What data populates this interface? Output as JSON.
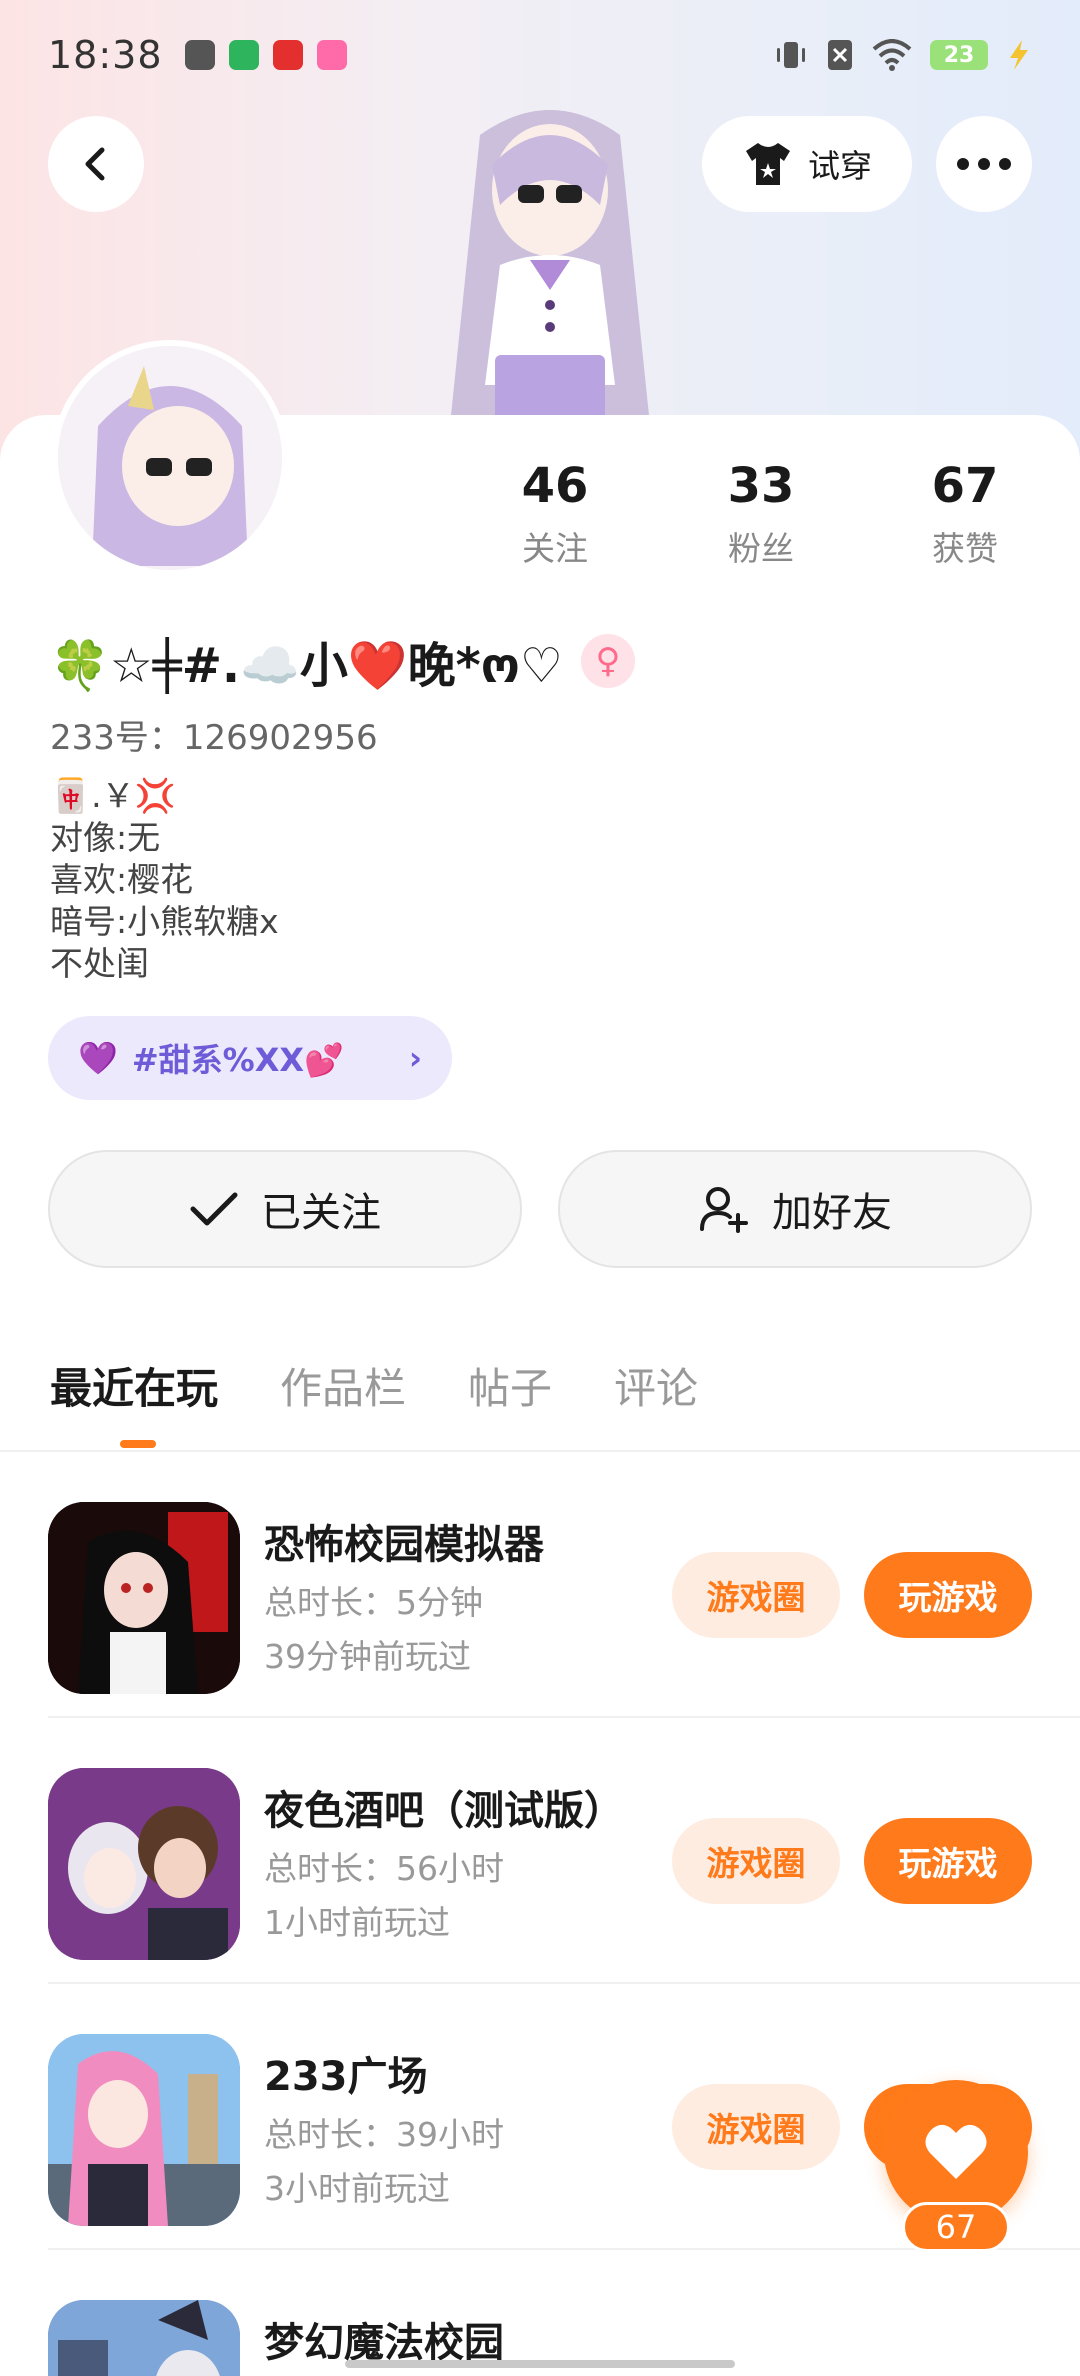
{
  "status_bar": {
    "time": "18:38",
    "battery": "23"
  },
  "header": {
    "try_on_label": "试穿"
  },
  "stats": [
    {
      "value": "46",
      "label": "关注"
    },
    {
      "value": "33",
      "label": "粉丝"
    },
    {
      "value": "67",
      "label": "获赞"
    }
  ],
  "profile": {
    "nickname": "🍀☆╪#.☁️小❤️晚*ო♡",
    "gender_symbol": "♀",
    "user_id": "233号：126902956",
    "bio_lines": [
      "🀄.￥💢",
      "对像:无",
      "喜欢:樱花",
      "暗号:小熊软糖x",
      "不处闺"
    ]
  },
  "tag": {
    "icon": "💜",
    "label": "#甜系%XX💕"
  },
  "actions": {
    "follow_label": "已关注",
    "add_friend_label": "加好友"
  },
  "tabs": [
    "最近在玩",
    "作品栏",
    "帖子",
    "评论"
  ],
  "games": [
    {
      "title": "恐怖校园模拟器",
      "duration": "总时长：5分钟",
      "last_played": "39分钟前玩过",
      "circle_label": "游戏圈",
      "play_label": "玩游戏",
      "icon_color": "#1a0a0a"
    },
    {
      "title": "夜色酒吧（测试版）",
      "duration": "总时长：56小时",
      "last_played": "1小时前玩过",
      "circle_label": "游戏圈",
      "play_label": "玩游戏",
      "icon_color": "#7a3a8a"
    },
    {
      "title": "233广场",
      "duration": "总时长：39小时",
      "last_played": "3小时前玩过",
      "circle_label": "游戏圈",
      "play_label": "玩游戏",
      "icon_color": "#6aa0d8"
    },
    {
      "title": "梦幻魔法校园",
      "duration": "",
      "last_played": "",
      "circle_label": "",
      "play_label": "",
      "icon_color": "#4a6aa8"
    }
  ],
  "fab": {
    "like_count": "67"
  },
  "colors": {
    "accent": "#ff7a1a",
    "tag_bg": "#ece9fd",
    "tag_text": "#6e5bd8"
  }
}
